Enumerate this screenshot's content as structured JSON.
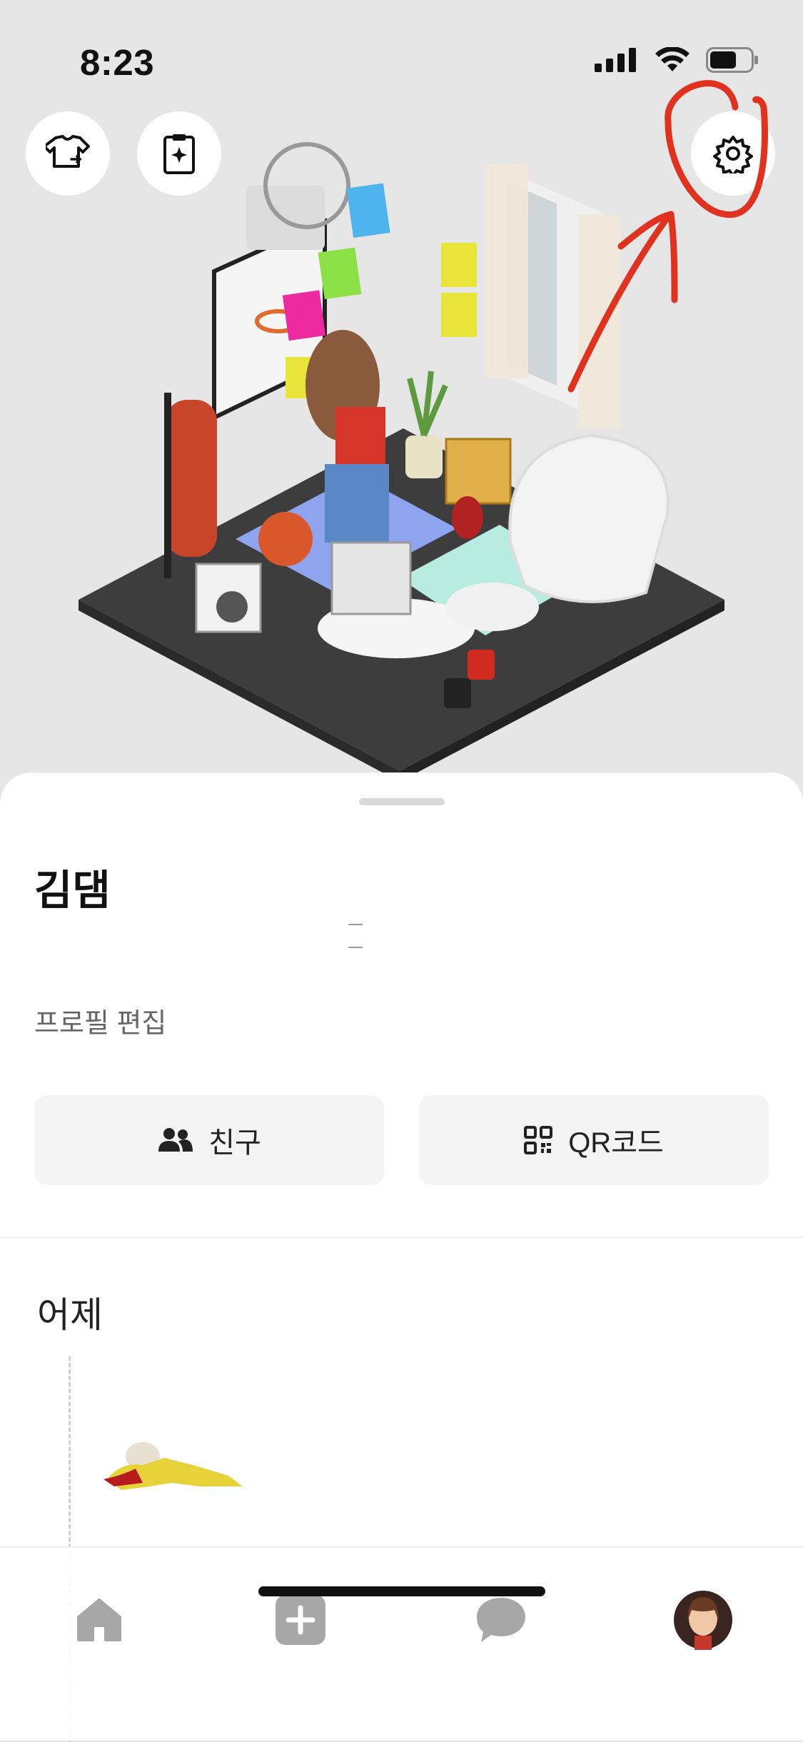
{
  "status_bar": {
    "time": "8:23",
    "battery_level": 0.65
  },
  "top_buttons": {
    "outfit": {
      "icon": "shirt-swap-icon"
    },
    "clipboard": {
      "icon": "clipboard-sparkle-icon"
    },
    "settings": {
      "icon": "gear-icon"
    }
  },
  "room": {
    "description_icon": "avatar-room-scene"
  },
  "annotation": {
    "color": "#e0321f"
  },
  "profile": {
    "name": "김댐",
    "edit_label": "프로필 편집"
  },
  "actions": {
    "friends_label": "친구",
    "friends_icon": "people-icon",
    "qr_label": "QR코드",
    "qr_icon": "qr-code-icon"
  },
  "feed": {
    "section_title": "어제"
  },
  "tab_bar": {
    "items": [
      {
        "name": "home",
        "icon": "home-icon"
      },
      {
        "name": "create",
        "icon": "plus-square-icon"
      },
      {
        "name": "chat",
        "icon": "chat-bubble-icon"
      },
      {
        "name": "profile",
        "icon": "avatar-icon"
      }
    ]
  },
  "colors": {
    "accent_tab_gray": "#a7a7a7",
    "sheet_bg": "#ffffff",
    "scene_bg": "#e6e6e6"
  }
}
